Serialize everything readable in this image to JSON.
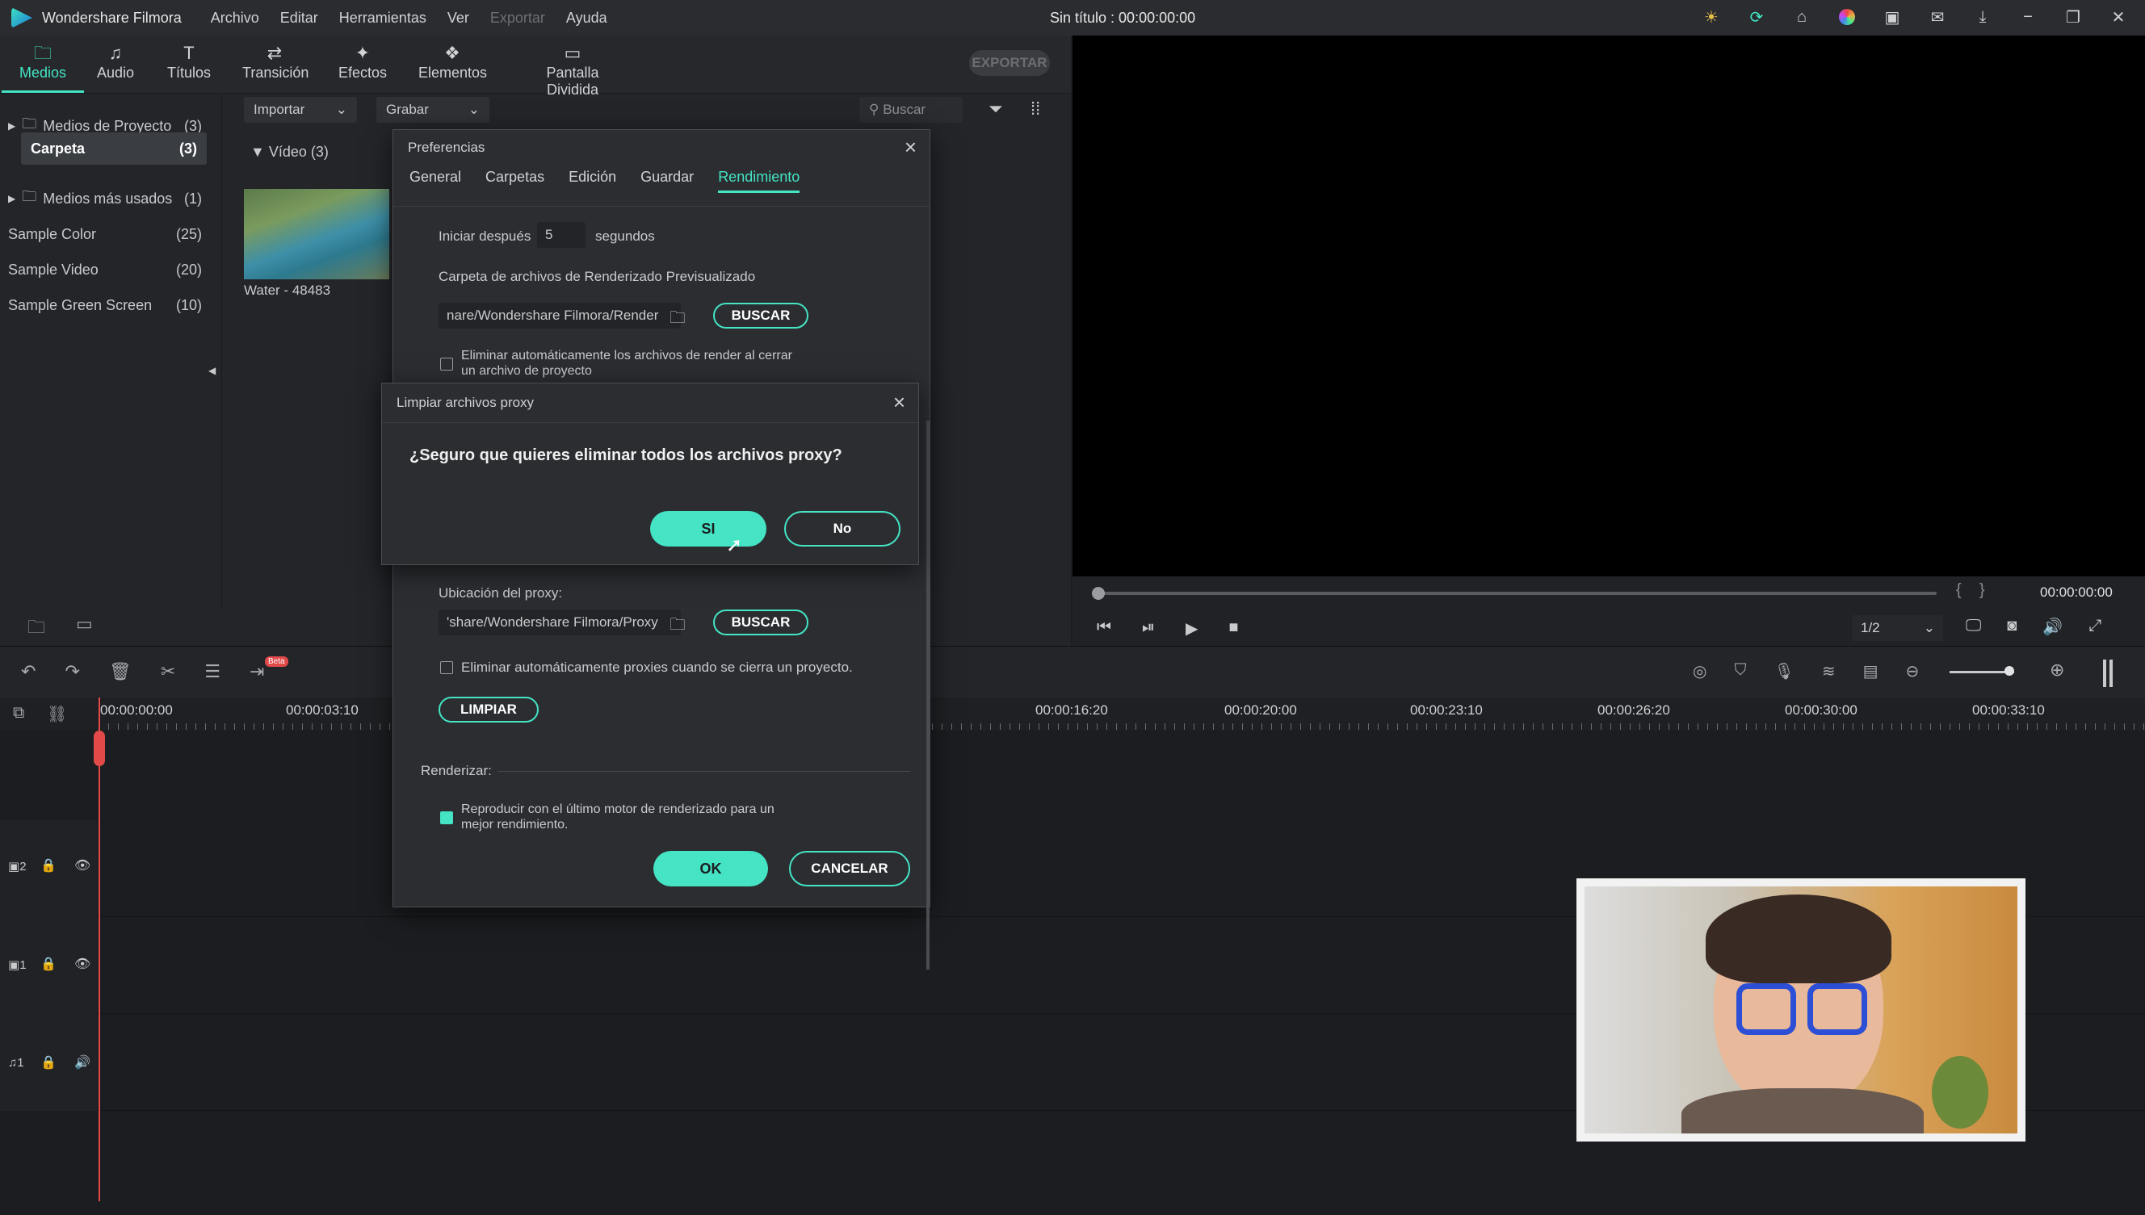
{
  "app": {
    "name": "Wondershare Filmora",
    "window_title": "Sin título : 00:00:00:00"
  },
  "menu": [
    "Archivo",
    "Editar",
    "Herramientas",
    "Ver",
    "Exportar",
    "Ayuda"
  ],
  "tabs": [
    {
      "label": "Medios",
      "icon": "folder-icon"
    },
    {
      "label": "Audio",
      "icon": "music-icon"
    },
    {
      "label": "Títulos",
      "icon": "text-icon"
    },
    {
      "label": "Transición",
      "icon": "transition-icon"
    },
    {
      "label": "Efectos",
      "icon": "effects-icon"
    },
    {
      "label": "Elementos",
      "icon": "elements-icon"
    },
    {
      "label": "Pantalla Dividida",
      "icon": "split-screen-icon"
    }
  ],
  "export_label": "EXPORTAR",
  "sidebar": {
    "items": [
      {
        "label": "Medios de Proyecto",
        "count": "(3)"
      },
      {
        "label": "Carpeta",
        "count": "(3)"
      },
      {
        "label": "Medios más usados",
        "count": "(1)"
      },
      {
        "label": "Sample Color",
        "count": "(25)"
      },
      {
        "label": "Sample Video",
        "count": "(20)"
      },
      {
        "label": "Sample Green Screen",
        "count": "(10)"
      }
    ]
  },
  "media": {
    "import": "Importar",
    "record": "Grabar",
    "search_placeholder": "Buscar",
    "group": "Vídeo (3)",
    "clip_name": "Water - 48483"
  },
  "preview": {
    "time": "00:00:00:00",
    "ratio": "1/2"
  },
  "timeline": {
    "ticks": [
      "00:00:00:00",
      "00:00:03:10",
      "00:00:16:20",
      "00:00:20:00",
      "00:00:23:10",
      "00:00:26:20",
      "00:00:30:00",
      "00:00:33:10"
    ],
    "beta": "Beta",
    "tracks": [
      "2",
      "1",
      "1"
    ]
  },
  "prefs": {
    "title": "Preferencias",
    "tabs": [
      "General",
      "Carpetas",
      "Edición",
      "Guardar",
      "Rendimiento"
    ],
    "start_after": "Iniciar después",
    "start_value": "5",
    "seconds": "segundos",
    "render_folder_label": "Carpeta de archivos de Renderizado Previsualizado",
    "render_path": "nare/Wondershare Filmora/Render",
    "browse": "BUSCAR",
    "auto_delete_render": "Eliminar automáticamente los archivos de render al cerrar un archivo de proyecto",
    "proxy_location": "Ubicación del proxy:",
    "proxy_path": "'share/Wondershare Filmora/Proxy",
    "auto_delete_proxy": "Eliminar automáticamente proxies cuando se cierra un proyecto.",
    "clean": "LIMPIAR",
    "render_section": "Renderizar:",
    "render_option": "Reproducir con el último motor de renderizado para un mejor rendimiento.",
    "ok": "OK",
    "cancel": "CANCELAR"
  },
  "confirm": {
    "title": "Limpiar archivos proxy",
    "question": "¿Seguro que quieres eliminar todos los archivos proxy?",
    "yes": "SI",
    "no": "No"
  },
  "colors": {
    "accent": "#44e4c4",
    "bg": "#1b1d20",
    "panel": "#232529"
  }
}
